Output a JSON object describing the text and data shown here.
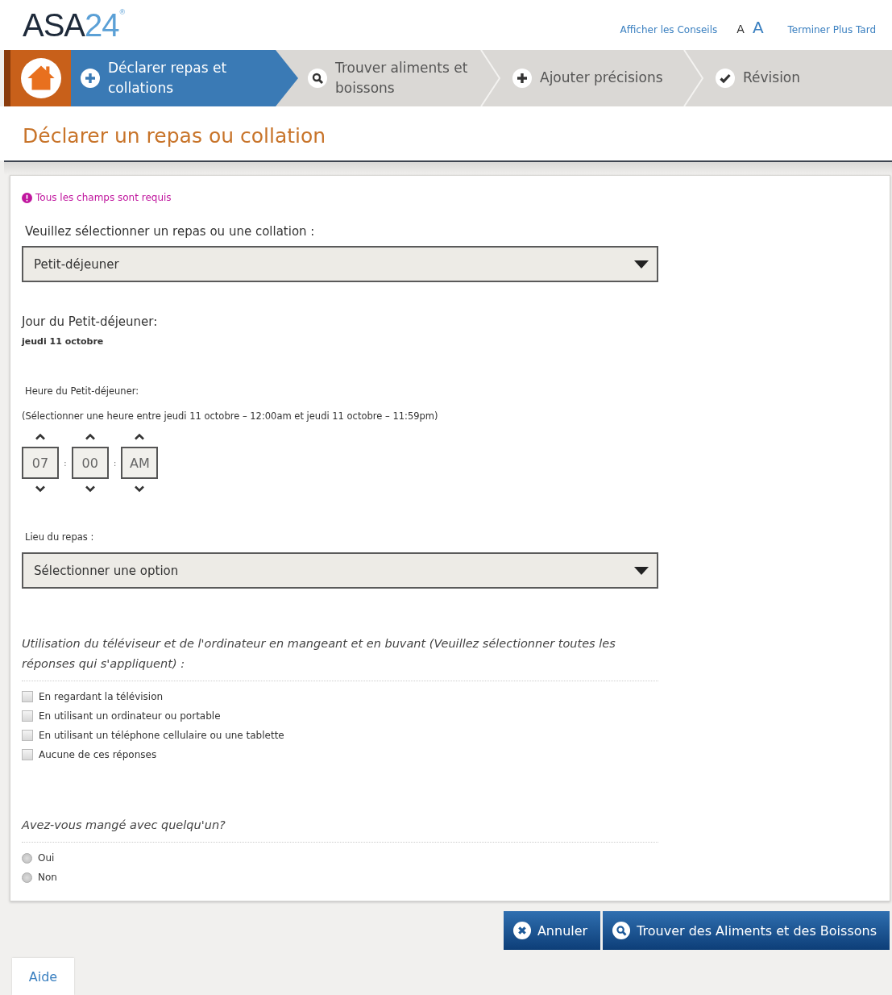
{
  "header": {
    "logo": [
      "ASA",
      "24"
    ],
    "logo_mark": "®",
    "tips_link": "Afficher les Conseils",
    "font_sizes": [
      {
        "label": "A",
        "kind": "small"
      },
      {
        "label": "A",
        "kind": "large"
      }
    ],
    "later_link": "Terminer Plus Tard"
  },
  "steps": [
    {
      "kind": "home",
      "selected": false
    },
    {
      "kind": "plus",
      "label": "Déclarer repas et collations",
      "selected": true
    },
    {
      "kind": "search",
      "label": "Trouver aliments et boissons",
      "selected": false
    },
    {
      "kind": "plus",
      "label": "Ajouter précisions",
      "selected": false
    },
    {
      "kind": "check",
      "label": "Révision",
      "selected": false
    }
  ],
  "page_title": "Déclarer un repas ou collation",
  "form": {
    "required_note": "Tous les champs sont requis",
    "meal_label": "Veuillez sélectionner un repas ou une collation :",
    "meal_value": "Petit-déjeuner",
    "day_label": "Jour du Petit-déjeuner:",
    "day_value": "jeudi 11 octobre",
    "time_label": "Heure du Petit-déjeuner:",
    "time_hint": "(Sélectionner une heure entre jeudi 11 octobre – 12:00am et jeudi 11 octobre – 11:59pm)",
    "time_fields": [
      "07",
      "00",
      "AM"
    ],
    "time_separator": ":",
    "place_label": "Lieu du repas :",
    "place_value": "Sélectionner une option",
    "screen_question": "Utilisation du téléviseur et de l'ordinateur en mangeant et en buvant (Veuillez sélectionner toutes les réponses qui s'appliquent) :",
    "screen_options": [
      {
        "label": "En regardant la télévision",
        "checked": false
      },
      {
        "label": "En utilisant un ordinateur ou portable",
        "checked": false
      },
      {
        "label": "En utilisant un téléphone cellulaire ou une tablette",
        "checked": false
      },
      {
        "label": "Aucune de ces réponses",
        "checked": false
      }
    ],
    "company_question": "Avez-vous mangé avec quelqu'un?",
    "company_options": [
      {
        "label": "Oui",
        "selected": false
      },
      {
        "label": "Non",
        "selected": false
      }
    ]
  },
  "footer": {
    "help_tab": "Aide",
    "buttons": [
      {
        "kind": "cancel",
        "label": "Annuler"
      },
      {
        "kind": "search",
        "label": "Trouver des Aliments et des Boissons"
      }
    ]
  }
}
